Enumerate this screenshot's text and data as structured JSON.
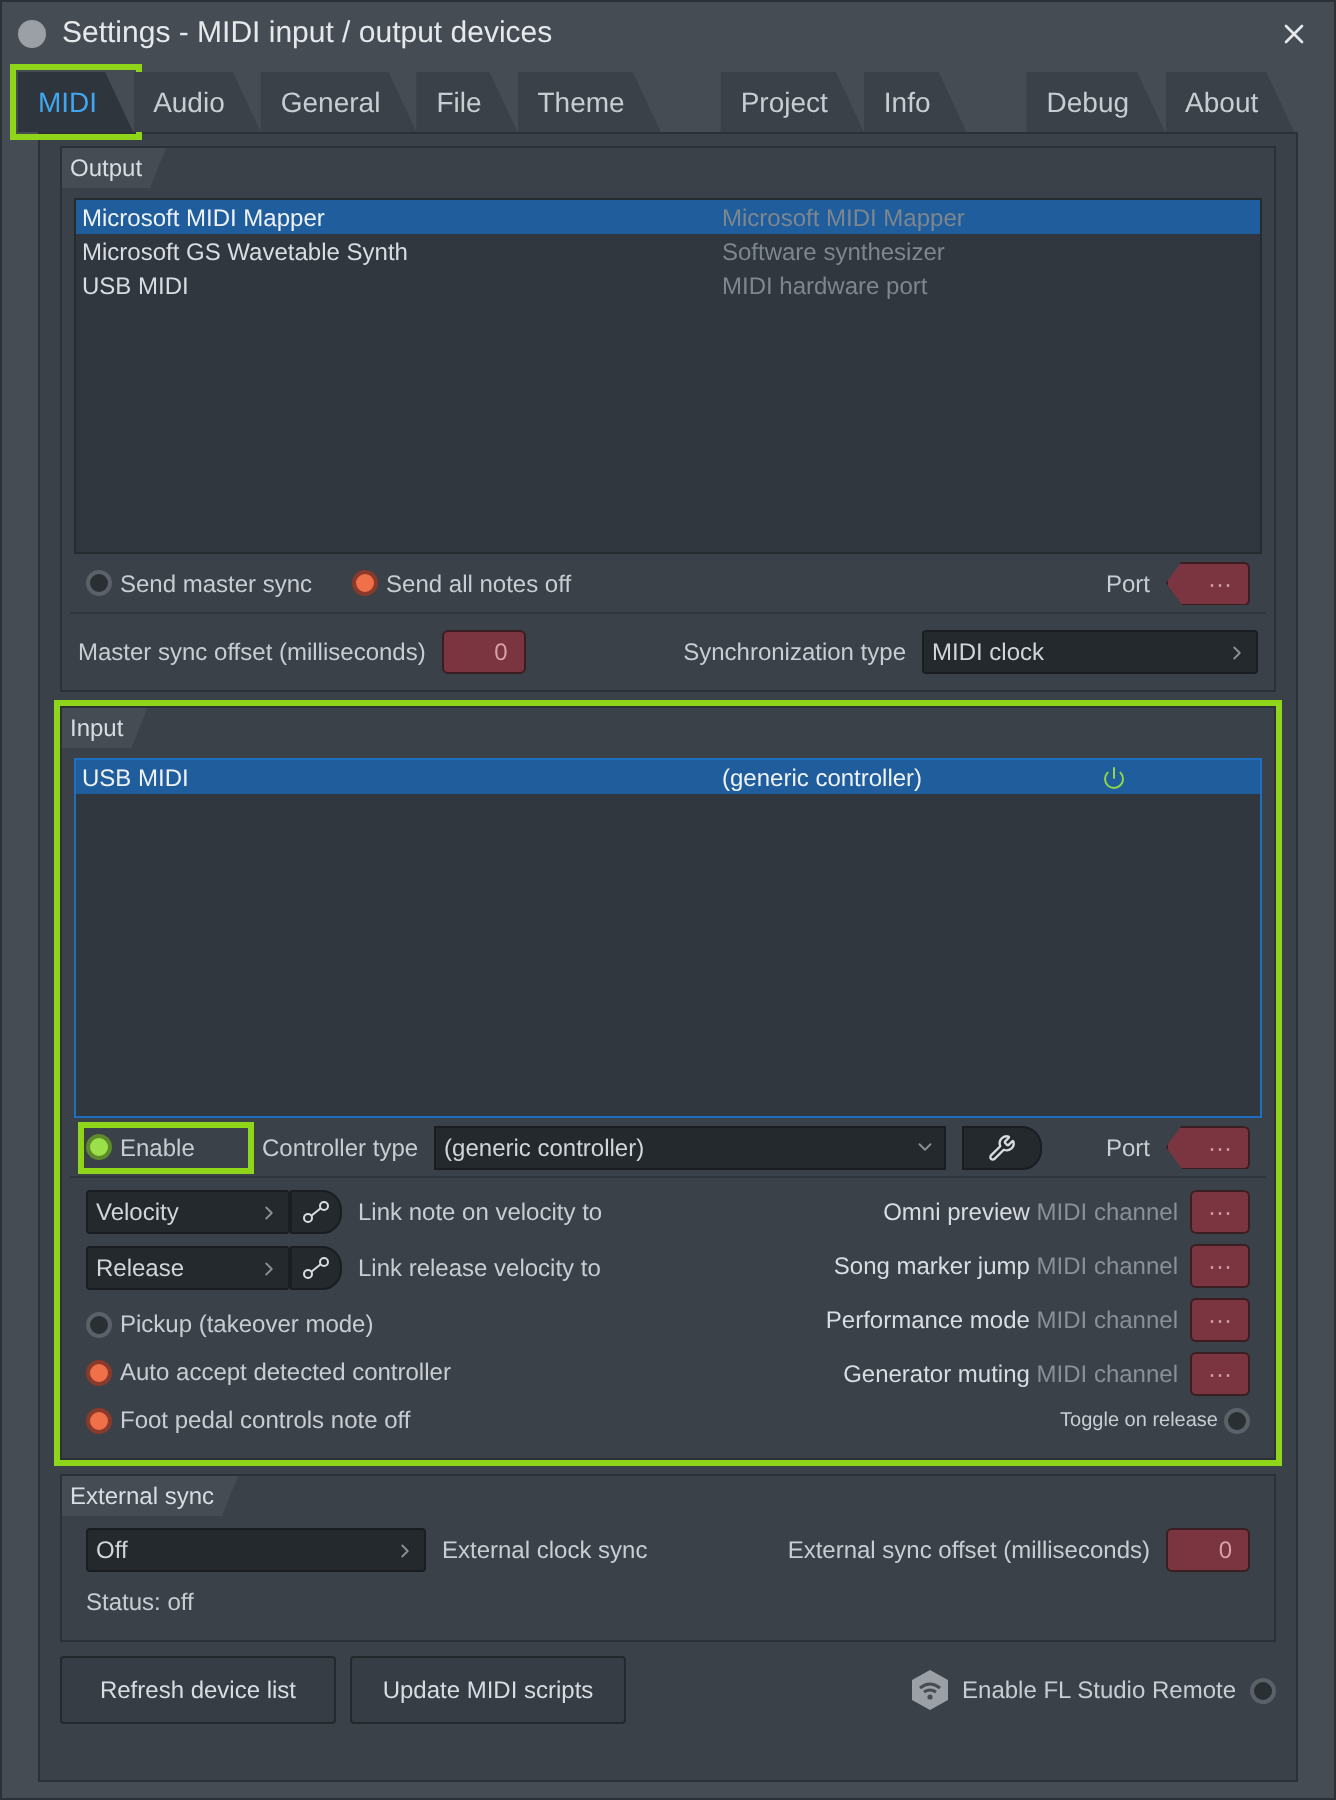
{
  "window": {
    "title": "Settings - MIDI input / output devices"
  },
  "tab_groups": [
    [
      {
        "label": "MIDI",
        "selected": true,
        "highlighted": true
      },
      {
        "label": "Audio",
        "selected": false,
        "highlighted": false
      },
      {
        "label": "General",
        "selected": false,
        "highlighted": false
      },
      {
        "label": "File",
        "selected": false,
        "highlighted": false
      },
      {
        "label": "Theme",
        "selected": false,
        "highlighted": false
      }
    ],
    [
      {
        "label": "Project",
        "selected": false,
        "highlighted": false
      },
      {
        "label": "Info",
        "selected": false,
        "highlighted": false
      }
    ],
    [
      {
        "label": "Debug",
        "selected": false,
        "highlighted": false
      },
      {
        "label": "About",
        "selected": false,
        "highlighted": false
      }
    ]
  ],
  "output": {
    "title": "Output",
    "devices": [
      {
        "name": "Microsoft MIDI Mapper",
        "description": "Microsoft MIDI Mapper",
        "selected": true
      },
      {
        "name": "Microsoft GS Wavetable Synth",
        "description": "Software synthesizer",
        "selected": false
      },
      {
        "name": "USB MIDI",
        "description": "MIDI hardware port",
        "selected": false
      }
    ],
    "options": [
      {
        "label": "Send master sync",
        "on": false
      },
      {
        "label": "Send all notes off",
        "on": true
      }
    ],
    "port": {
      "label": "Port",
      "value": "···"
    },
    "sync_offset": {
      "label": "Master sync offset (milliseconds)",
      "value": "0"
    },
    "sync_type": {
      "label": "Synchronization type",
      "value": "MIDI clock"
    }
  },
  "input": {
    "title": "Input",
    "highlighted": true,
    "devices": [
      {
        "name": "USB MIDI",
        "controller": "(generic controller)",
        "enabled": true,
        "selected": true
      }
    ],
    "enable": {
      "label": "Enable",
      "on": true,
      "highlighted": true
    },
    "controller_type": {
      "label": "Controller type",
      "value": "(generic controller)"
    },
    "port": {
      "label": "Port",
      "value": "···"
    },
    "links": [
      {
        "value": "Velocity",
        "label": "Link note on velocity to"
      },
      {
        "value": "Release",
        "label": "Link release velocity to"
      }
    ],
    "options": [
      {
        "label": "Pickup (takeover mode)",
        "on": false
      },
      {
        "label": "Auto accept detected controller",
        "on": true
      },
      {
        "label": "Foot pedal controls note off",
        "on": true
      }
    ],
    "channels": [
      {
        "label": "Omni preview",
        "suffix": "MIDI channel",
        "value": "···"
      },
      {
        "label": "Song marker jump",
        "suffix": "MIDI channel",
        "value": "···"
      },
      {
        "label": "Performance mode",
        "suffix": "MIDI channel",
        "value": "···"
      },
      {
        "label": "Generator muting",
        "suffix": "MIDI channel",
        "value": "···"
      }
    ],
    "toggle_on_release": {
      "label": "Toggle on release",
      "on": false
    }
  },
  "external_sync": {
    "title": "External sync",
    "mode": {
      "value": "Off",
      "label": "External clock sync"
    },
    "offset": {
      "label": "External sync offset (milliseconds)",
      "value": "0"
    },
    "status": "Status: off"
  },
  "buttons": [
    "Refresh device list",
    "Update MIDI scripts"
  ],
  "remote": {
    "label": "Enable FL Studio Remote",
    "on": false
  }
}
